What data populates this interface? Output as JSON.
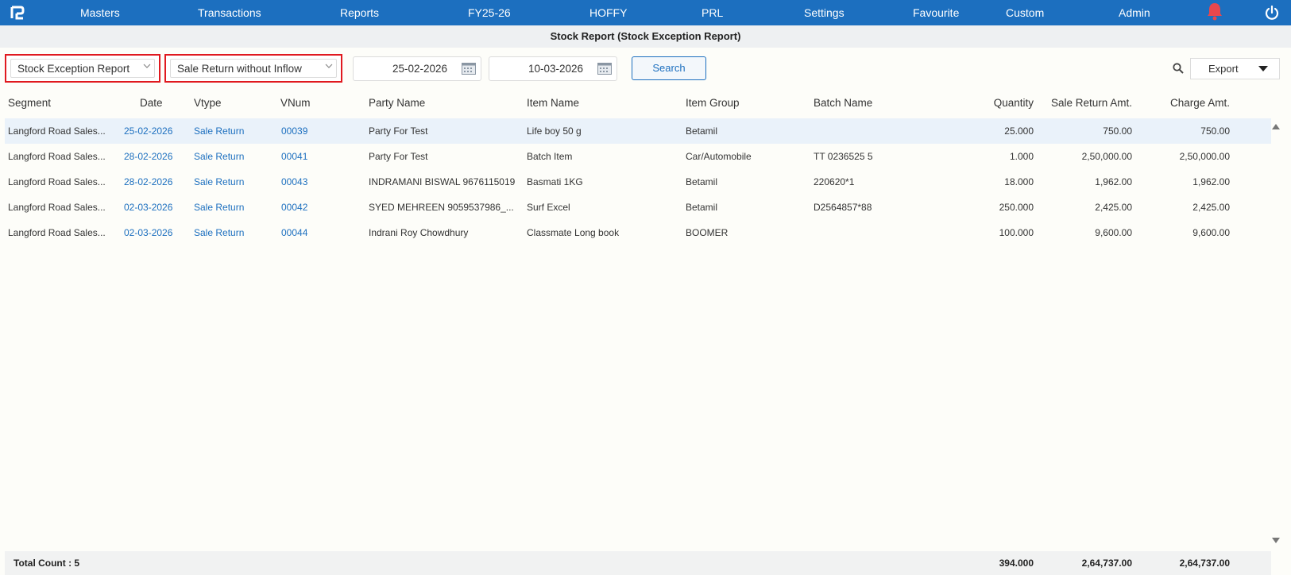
{
  "nav": {
    "items": [
      "Masters",
      "Transactions",
      "Reports",
      "FY25-26",
      "HOFFY",
      "PRL",
      "Settings",
      "Favourite",
      "Custom",
      "Admin"
    ]
  },
  "title": "Stock Report (Stock Exception Report)",
  "filters": {
    "report_type": "Stock Exception Report",
    "exception_type": "Sale Return without Inflow",
    "from_date": "25-02-2026",
    "to_date": "10-03-2026",
    "search_label": "Search",
    "export_label": "Export"
  },
  "table": {
    "columns": [
      "Segment",
      "Date",
      "Vtype",
      "VNum",
      "Party Name",
      "Item Name",
      "Item Group",
      "Batch Name",
      "Quantity",
      "Sale Return Amt.",
      "Charge Amt."
    ],
    "rows": [
      [
        "Langford Road Sales...",
        "25-02-2026",
        "Sale Return",
        "00039",
        "Party For Test",
        "Life boy 50 g",
        "Betamil",
        "",
        "25.000",
        "750.00",
        "750.00"
      ],
      [
        "Langford Road Sales...",
        "28-02-2026",
        "Sale Return",
        "00041",
        "Party For Test",
        "Batch Item",
        "Car/Automobile",
        "TT 0236525 5",
        "1.000",
        "2,50,000.00",
        "2,50,000.00"
      ],
      [
        "Langford Road Sales...",
        "28-02-2026",
        "Sale Return",
        "00043",
        "INDRAMANI BISWAL 9676115019",
        "Basmati 1KG",
        "Betamil",
        "220620*1",
        "18.000",
        "1,962.00",
        "1,962.00"
      ],
      [
        "Langford Road Sales...",
        "02-03-2026",
        "Sale Return",
        "00042",
        "SYED MEHREEN 9059537986_...",
        "Surf Excel",
        "Betamil",
        "D2564857*88",
        "250.000",
        "2,425.00",
        "2,425.00"
      ],
      [
        "Langford Road Sales...",
        "02-03-2026",
        "Sale Return",
        "00044",
        "Indrani Roy Chowdhury",
        "Classmate Long book",
        "BOOMER",
        "",
        "100.000",
        "9,600.00",
        "9,600.00"
      ]
    ]
  },
  "footer": {
    "total_count": "Total Count : 5",
    "quantity": "394.000",
    "sale_return_amt": "2,64,737.00",
    "charge_amt": "2,64,737.00"
  },
  "colors": {
    "nav_bg": "#1c6fbf",
    "link": "#1c6fbf",
    "highlight_border": "#e0191f",
    "selected_row": "#eaf2fa",
    "bell": "#e8474d"
  }
}
